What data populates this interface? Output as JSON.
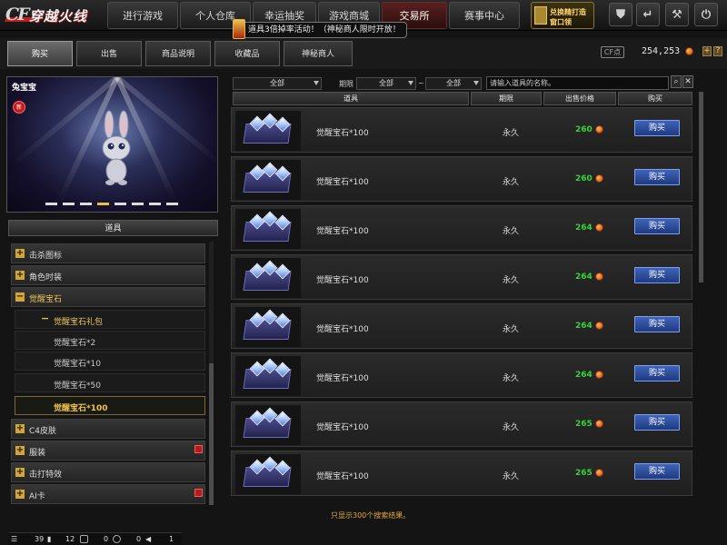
{
  "logo": {
    "cf": "CF",
    "name": "穿越火线"
  },
  "nav": {
    "tabs": [
      {
        "label": "进行游戏",
        "active": false
      },
      {
        "label": "个人仓库",
        "active": false
      },
      {
        "label": "幸运抽奖",
        "active": false
      },
      {
        "label": "游戏商城",
        "active": false
      },
      {
        "label": "交易所",
        "active": true
      },
      {
        "label": "赛事中心",
        "active": false
      }
    ],
    "gift_line1": "兑换精打造",
    "gift_line2": "窗口领",
    "system_icons": [
      "shield-icon",
      "back-icon",
      "wrench-icon",
      "power-icon"
    ]
  },
  "promo": {
    "text": "道具3倍掉率活动！（神秘商人限时开放！"
  },
  "subtabs": [
    {
      "label": "购买",
      "active": true
    },
    {
      "label": "出售",
      "active": false
    },
    {
      "label": "商品说明",
      "active": false
    },
    {
      "label": "收藏品",
      "active": false
    },
    {
      "label": "神秘商人",
      "active": false
    }
  ],
  "account": {
    "cf_points_label": "CF点",
    "balance": "254,253",
    "plus": "+",
    "extra": "?"
  },
  "preview": {
    "title": "兔宝宝",
    "badge": "新",
    "dots": 8,
    "active_dot": 3
  },
  "category": {
    "header": "道具",
    "nodes": [
      {
        "label": "击杀图标",
        "hot": false
      },
      {
        "label": "角色时装",
        "hot": false
      },
      {
        "label": "觉醒宝石",
        "open": true
      }
    ],
    "sub": {
      "group": "觉醒宝石礼包",
      "items": [
        "觉醒宝石*2",
        "觉醒宝石*10",
        "觉醒宝石*50",
        "觉醒宝石*100"
      ],
      "selected": 3
    },
    "after_nodes": [
      {
        "label": "C4皮肤",
        "hot": false
      },
      {
        "label": "服装",
        "hot": true
      },
      {
        "label": "击打特效",
        "hot": false
      },
      {
        "label": "AI卡",
        "hot": true
      }
    ]
  },
  "filters": {
    "type": "全部",
    "period_label": "期限",
    "period_from": "全部",
    "tilde": "~",
    "period_to": "全部",
    "search_placeholder": "请输入道具的名称。"
  },
  "table": {
    "headers": [
      "道具",
      "期限",
      "出售价格",
      "购买"
    ],
    "rows": [
      {
        "name": "觉醒宝石*100",
        "duration": "永久",
        "price": "260",
        "buy": "购买"
      },
      {
        "name": "觉醒宝石*100",
        "duration": "永久",
        "price": "260",
        "buy": "购买"
      },
      {
        "name": "觉醒宝石*100",
        "duration": "永久",
        "price": "264",
        "buy": "购买"
      },
      {
        "name": "觉醒宝石*100",
        "duration": "永久",
        "price": "264",
        "buy": "购买"
      },
      {
        "name": "觉醒宝石*100",
        "duration": "永久",
        "price": "264",
        "buy": "购买"
      },
      {
        "name": "觉醒宝石*100",
        "duration": "永久",
        "price": "264",
        "buy": "购买"
      },
      {
        "name": "觉醒宝石*100",
        "duration": "永久",
        "price": "265",
        "buy": "购买"
      },
      {
        "name": "觉醒宝石*100",
        "duration": "永久",
        "price": "265",
        "buy": "购买"
      }
    ],
    "footer": "只显示300个搜索结果。"
  },
  "statusbar": {
    "items": [
      "39",
      "12",
      "0",
      "0",
      "1"
    ]
  },
  "colors": {
    "accent_gold": "#d4a733",
    "price_green": "#39d339",
    "buy_blue": "#2d4fa0",
    "active_tab_red": "#5a2020"
  }
}
